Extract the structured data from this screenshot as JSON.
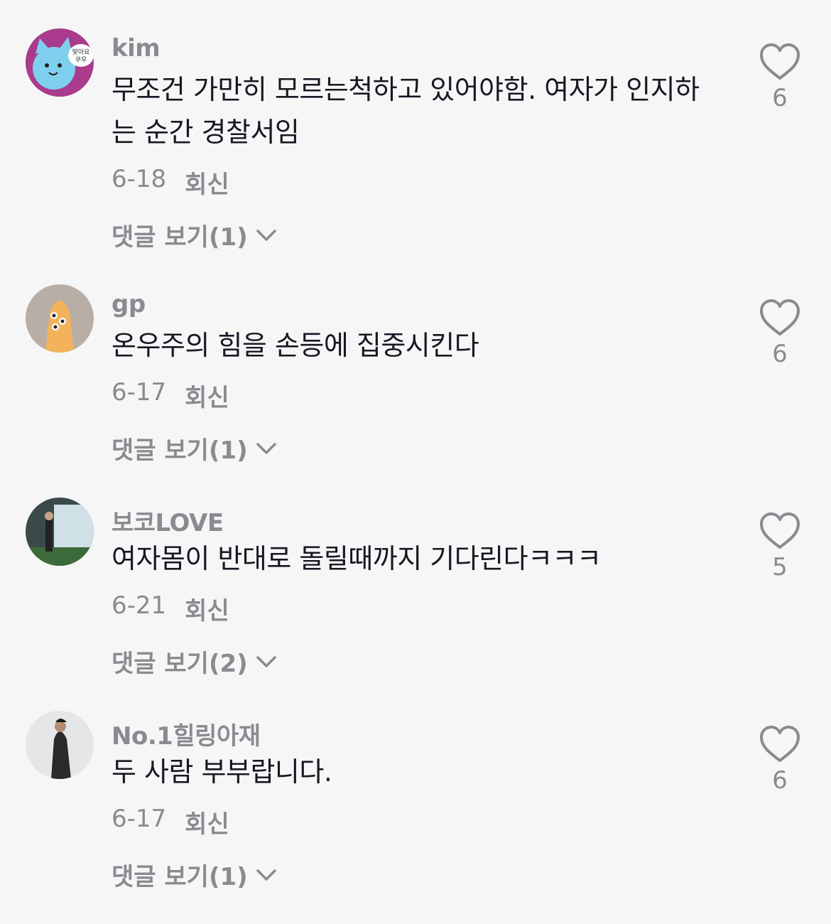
{
  "comments": [
    {
      "username": "kim",
      "text": "무조건 가만히 모르는척하고 있어야함. 여자가 인지하는 순간 경찰서임",
      "date": "6-18",
      "reply_label": "회신",
      "view_replies": "댓글 보기(1)",
      "likes": "6",
      "avatar_sticker_text": "맞아요 쿠우"
    },
    {
      "username": "gp",
      "text": "온우주의 힘을 손등에 집중시킨다",
      "date": "6-17",
      "reply_label": "회신",
      "view_replies": "댓글 보기(1)",
      "likes": "6"
    },
    {
      "username": "보코LOVE",
      "text": "여자몸이 반대로 돌릴때까지 기다린다ㅋㅋㅋ",
      "date": "6-21",
      "reply_label": "회신",
      "view_replies": "댓글 보기(2)",
      "likes": "5"
    },
    {
      "username": "No.1힐링아재",
      "text": "두 사람 부부랍니다.",
      "date": "6-17",
      "reply_label": "회신",
      "view_replies": "댓글 보기(1)",
      "likes": "6"
    }
  ],
  "icons": {
    "like": "heart-outline-icon",
    "expand": "chevron-down-icon"
  },
  "colors": {
    "background": "#f6f6f6",
    "text": "#161823",
    "secondary": "#8a8b91"
  }
}
